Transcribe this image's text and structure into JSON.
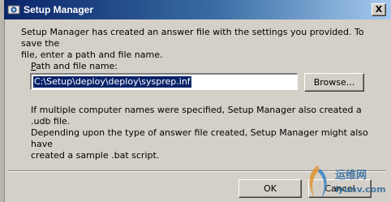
{
  "window": {
    "title": "Setup Manager",
    "close_glyph": "X",
    "app_icon": "setup-manager-icon"
  },
  "dialog": {
    "intro_line1": "Setup Manager has created an answer file with the settings you provided. To save the",
    "intro_line2": "file, enter a path and file name.",
    "path_label_accel": "P",
    "path_label_rest": "ath and file name:",
    "path_value": "C:\\Setup\\deploy\\deploy\\sysprep.inf",
    "browse_label": "Browse...",
    "note_line1": "If multiple computer names were specified, Setup Manager also created a .udb file.",
    "note_line2": "Depending upon the type of answer file created, Setup Manager might also have",
    "note_line3": "created a sample .bat script.",
    "ok_label": "OK",
    "cancel_label": "Cancel"
  },
  "watermark": {
    "text": "运维网",
    "url": "iyunv.com"
  },
  "colors": {
    "title_start": "#0a246a",
    "title_end": "#a6caf0",
    "face": "#d4d0c8",
    "selection": "#0a246a"
  }
}
